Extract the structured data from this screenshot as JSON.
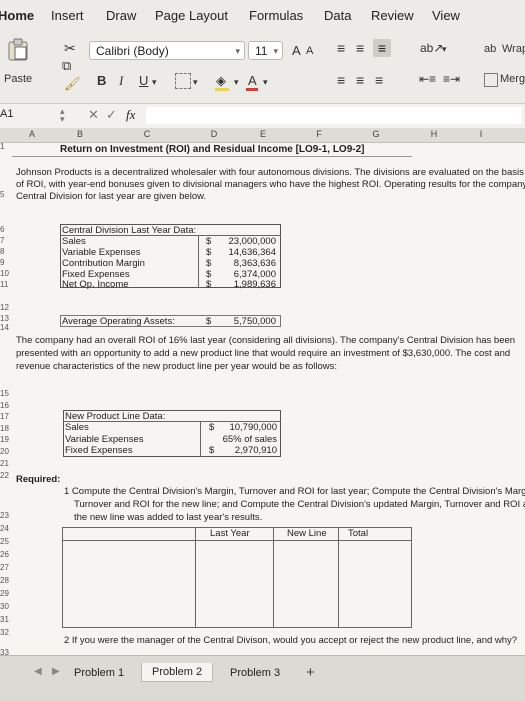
{
  "ribbon": {
    "tabs": [
      "Home",
      "Insert",
      "Draw",
      "Page Layout",
      "Formulas",
      "Data",
      "Review",
      "View"
    ],
    "paste_label": "Paste",
    "font_name": "Calibri (Body)",
    "font_size": "11",
    "grow_font": "A",
    "shrink_font": "A",
    "bold": "B",
    "italic": "I",
    "underline": "U",
    "wrap_label": "Wrap",
    "merge_label": "Merge"
  },
  "formula_bar": {
    "cell_ref": "A1",
    "fx": "fx",
    "cancel": "✕",
    "enter": "✓"
  },
  "columns": [
    "A",
    "B",
    "C",
    "D",
    "E",
    "F",
    "G",
    "H",
    "I"
  ],
  "sheet": {
    "title": "Return on Investment (ROI) and Residual Income [LO9-1, LO9-2]",
    "intro": [
      "Johnson Products is a decentralized wholesaler with four autonomous divisions. The divisions are evaluated on the basis",
      "of ROI, with year-end bonuses given to divisional managers who have the highest ROI. Operating results for the company's",
      "Central Division for last year are given below."
    ],
    "central": {
      "header": "Central Division Last Year Data:",
      "rows": [
        {
          "label": "Sales",
          "cur": "$",
          "value": "23,000,000"
        },
        {
          "label": "Variable Expenses",
          "cur": "$",
          "value": "14,636,364"
        },
        {
          "label": "Contribution Margin",
          "cur": "$",
          "value": "8,363,636"
        },
        {
          "label": "Fixed Expenses",
          "cur": "$",
          "value": "6,374,000"
        },
        {
          "label": "Net Op. Income",
          "cur": "$",
          "value": "1,989,636"
        }
      ]
    },
    "avg_assets": {
      "label": "Average Operating Assets:",
      "cur": "$",
      "value": "5,750,000"
    },
    "para2": [
      "The company had an overall ROI of 16% last year (considering all divisions). The company's Central Division has been",
      "presented with an opportunity to add a new product line that would require an investment of $3,630,000. The cost and",
      "revenue characteristics of the new product line per year would be as follows:"
    ],
    "newline": {
      "header": "New Product Line Data:",
      "rows": [
        {
          "label": "Sales",
          "cur": "$",
          "value": "10,790,000"
        },
        {
          "label": "Variable Expenses",
          "cur": "",
          "value": "65% of sales"
        },
        {
          "label": "Fixed Expenses",
          "cur": "$",
          "value": "2,970,910"
        }
      ]
    },
    "required": "Required:",
    "q1": [
      "1  Compute the Central Division's Margin, Turnover and ROI for last year; Compute the Central Division's Margin,",
      "Turnover and ROI for the new line; and Compute the Central Division's updated Margin, Turnover and ROI as if",
      "the new line was added to last year's results."
    ],
    "answer_headers": [
      "Last Year",
      "New Line",
      "Total"
    ],
    "q2": "2  If you were the manager of the Central Divison, would you accept or reject the new product line, and why?",
    "row_numbers": [
      "1",
      "5",
      "6",
      "7",
      "8",
      "9",
      "10",
      "11",
      "12",
      "13",
      "14",
      "15",
      "16",
      "17",
      "18",
      "19",
      "20",
      "21",
      "22",
      "23",
      "24",
      "25",
      "26",
      "27",
      "28",
      "29",
      "30",
      "31",
      "32",
      "33"
    ]
  },
  "sheet_tabs": [
    "Problem 1",
    "Problem 2",
    "Problem 3"
  ],
  "add_sheet": "+"
}
